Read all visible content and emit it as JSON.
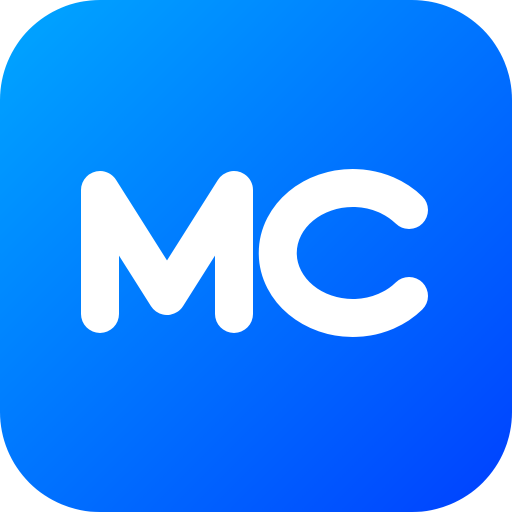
{
  "icon": {
    "monogram": "MC",
    "gradient_start": "#00A7FF",
    "gradient_end": "#0040FF",
    "letter_color": "#FFFFFF"
  }
}
